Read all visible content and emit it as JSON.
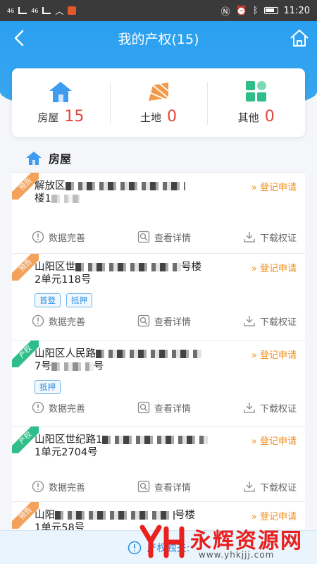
{
  "statusbar": {
    "network_left": "46",
    "network_right": "46",
    "time": "11:20"
  },
  "header": {
    "title": "我的产权(15)"
  },
  "summary": [
    {
      "label": "房屋",
      "count": "15",
      "icon": "house-icon"
    },
    {
      "label": "土地",
      "count": "0",
      "icon": "land-icon"
    },
    {
      "label": "其他",
      "count": "0",
      "icon": "grid-icon"
    }
  ],
  "section": {
    "title": "房屋"
  },
  "cards": [
    {
      "ribbon": "预告",
      "addr1": "解放区",
      "addr2": "楼1",
      "apply": "» 登记申请",
      "tags": []
    },
    {
      "ribbon": "预告",
      "addr1": "山阳区世",
      "addr1_tail": "号楼",
      "addr2": "2单元118号",
      "apply": "» 登记申请",
      "tags": [
        "首登",
        "抵押"
      ]
    },
    {
      "ribbon": "产权",
      "addr1": "山阳区人民路",
      "addr2": "7号",
      "addr2_tail": "号",
      "apply": "» 登记申请",
      "tags": [
        "抵押"
      ]
    },
    {
      "ribbon": "产权",
      "addr1": "山阳区世纪路1",
      "addr2": "1单元2704号",
      "apply": "» 登记申请",
      "tags": []
    },
    {
      "ribbon": "预告",
      "addr1": "山阳",
      "addr1_tail": "号楼",
      "addr2": "1单元58号",
      "apply": "» 登记申请",
      "tags": []
    }
  ],
  "actions": {
    "complete": "数据完善",
    "detail": "查看详情",
    "download": "下载权证"
  },
  "bottombar": {
    "text": "产权独夫:"
  },
  "watermark": {
    "brand": "永辉资源网",
    "url": "www.yhkjjj.com"
  },
  "colors": {
    "primary": "#2aa0f0",
    "accent": "#e0473a",
    "apply": "#f09020"
  }
}
